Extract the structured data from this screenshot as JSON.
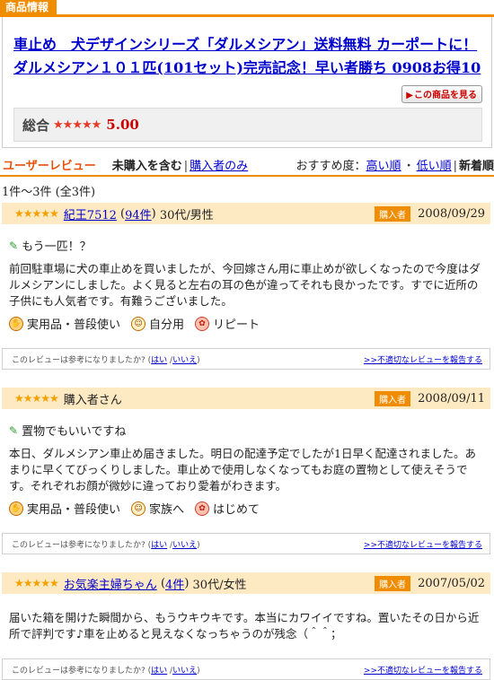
{
  "product": {
    "section_tab": "商品情報",
    "title": "車止め　犬デザインシリーズ「ダルメシアン」送料無料 カーポートに！ダルメシアン１０１匹(101セット)完売記念！早い者勝ち 0908お得10",
    "see_button": "この商品を見る",
    "rating_label": "総合",
    "rating_stars": "★★★★★",
    "rating_value": "5.00"
  },
  "reviews_header": {
    "title": "ユーザーレビュー",
    "filter_all": "未購入を含む",
    "filter_buyers": "購入者のみ",
    "sort_label": "おすすめ度：",
    "sort_high": "高い順",
    "sort_low": "低い順",
    "sort_new": "新着順",
    "count": "1件～3件 (全3件)"
  },
  "help_text": "このレビューは参考になりましたか? (",
  "help_yes": "はい",
  "help_no": "いいえ",
  "help_close": ")",
  "report_link": ">>不適切なレビューを報告する",
  "reviews": [
    {
      "stars": "★★★★★",
      "user": "紀王7512",
      "user_count": "94件",
      "user_meta": "30代/男性",
      "badge": "購入者",
      "date": "2008/09/29",
      "subject": "もう一匹！？",
      "body": "前回駐車場に犬の車止めを買いましたが、今回嫁さん用に車止めが欲しくなったので今度はダルメシアンにしました。よく見ると左右の耳の色が違ってそれも良かったです。すでに近所の子供にも人気者です。有難うございました。",
      "tags": [
        "実用品・普段使い",
        "自分用",
        "リピート"
      ]
    },
    {
      "stars": "★★★★★",
      "user": "購入者さん",
      "badge": "購入者",
      "date": "2008/09/11",
      "subject": "置物でもいいですね",
      "body": "本日、ダルメシアン車止め届きました。明日の配達予定でしたが1日早く配達されました。あまりに早くてびっくりしました。車止めで使用しなくなってもお庭の置物として使えそうです。それぞれお顔が微妙に違っており愛着がわきます。",
      "tags": [
        "実用品・普段使い",
        "家族へ",
        "はじめて"
      ]
    },
    {
      "stars": "★★★★★",
      "user": "お気楽主婦ちゃん",
      "user_count": "4件",
      "user_meta": "30代/女性",
      "badge": "購入者",
      "date": "2007/05/02",
      "body": "届いた箱を開けた瞬間から、もうウキウキです。本当にカワイイですね。置いたその日から近所で評判です♪車を止めると見えなくなっちゃうのが残念（＾＾；"
    }
  ]
}
